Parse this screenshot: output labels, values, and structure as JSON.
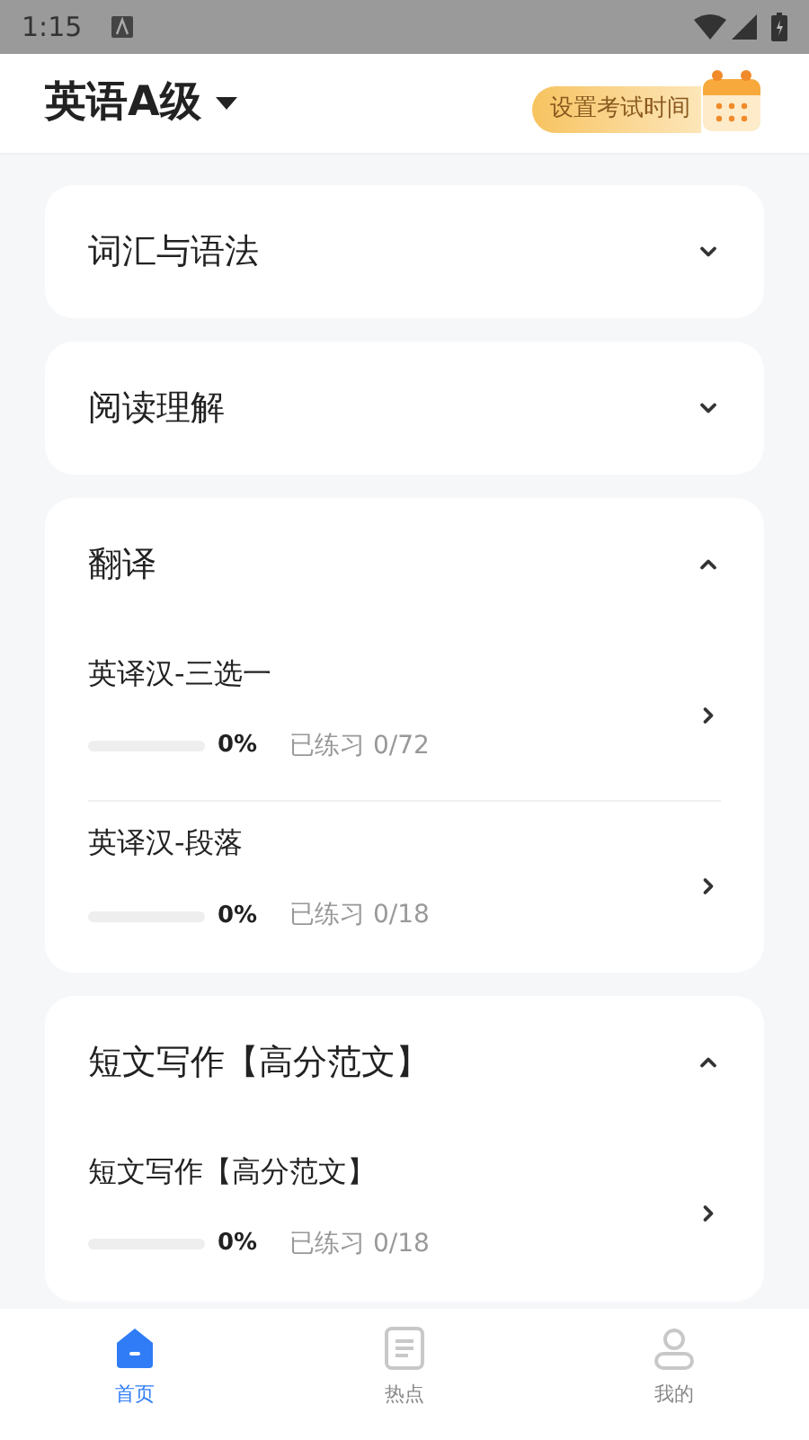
{
  "status_bar": {
    "time": "1:15"
  },
  "header": {
    "title": "英语A级",
    "exam_button": "设置考试时间"
  },
  "sections": [
    {
      "title": "词汇与语法",
      "expanded": false
    },
    {
      "title": "阅读理解",
      "expanded": false
    },
    {
      "title": "翻译",
      "expanded": true,
      "items": [
        {
          "title": "英译汉-三选一",
          "level": 0,
          "percent": "0%",
          "progress": "已练习 0/72"
        },
        {
          "title": "英译汉-段落",
          "level": 0,
          "percent": "0%",
          "progress": "已练习 0/18"
        }
      ]
    },
    {
      "title": "短文写作【高分范文】",
      "expanded": true,
      "items": [
        {
          "title": "短文写作【高分范文】",
          "level": 0,
          "percent": "0%",
          "progress": "已练习 0/18"
        }
      ]
    }
  ],
  "tabs": [
    {
      "label": "首页",
      "selected": true,
      "kind": "home"
    },
    {
      "label": "热点",
      "selected": false,
      "kind": "news"
    },
    {
      "label": "我的",
      "selected": false,
      "kind": "profile"
    }
  ]
}
